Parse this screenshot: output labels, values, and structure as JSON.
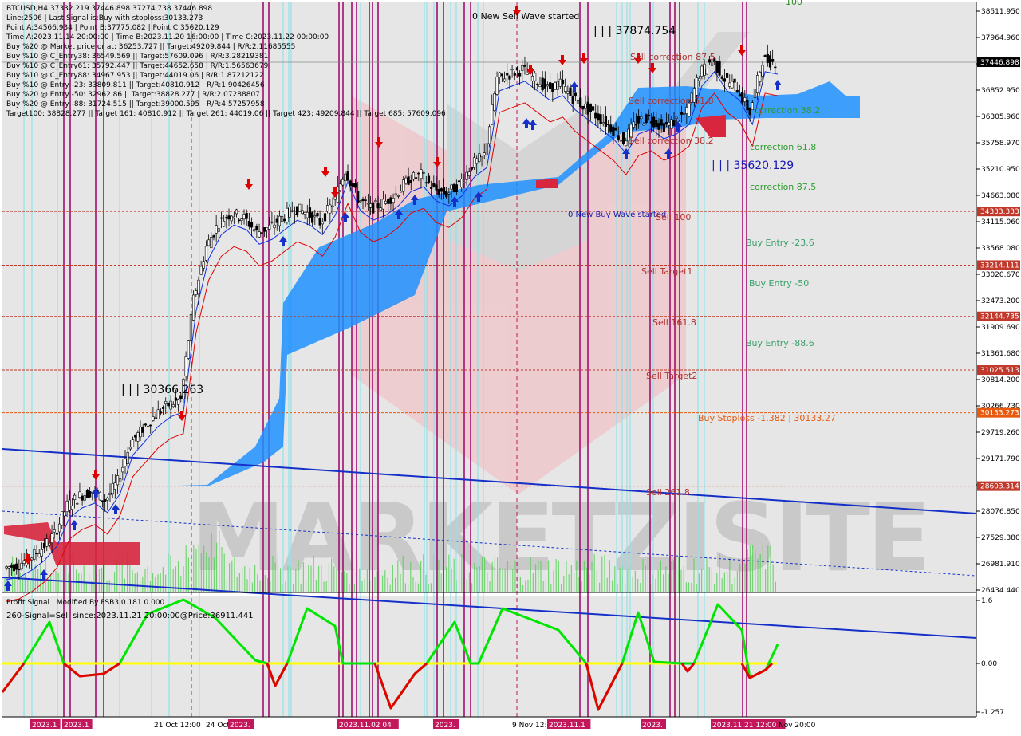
{
  "info_lines": [
    "BTCUSD,H4  37332.219 37446.898 37274.738 37446.898",
    "Line:2506 | Last Signal is:Buy with stoploss:30133.273",
    "Point A:34566.934 | Point B:37775.082 | Point C:35620.129",
    "Time A:2023.11.14 20:00:00 | Time B:2023.11.20 16:00:00 | Time C:2023.11.22 00:00:00",
    "Buy %20 @ Market price or at: 36253.727 || Target:49209.844 | R/R:2.11685555",
    "Buy %10 @ C_Entry38: 36549.569 || Target:57609.096 | R/R:3.28219381",
    "Buy %10 @ C_Entry61: 35792.447 || Target:44652.658 | R/R:1.56563679",
    "Buy %10 @ C_Entry88: 34967.953 || Target:44019.06 | R/R:1.87212122",
    "Buy %10 @ Entry -23: 33809.811 || Target:40810.912 | R/R:1.90426456",
    "Buy %20 @ Entry -50: 32962.86 || Target:38828.277 | R/R:2.07288807",
    "Buy %20 @ Entry -88: 31724.515 || Target:39000.595 | R/R:4.57257958",
    "Target100: 38828.277 || Target 161: 40810.912 || Target 261: 44019.06 || Target 423: 49209.844 || Target 685: 57609.096"
  ],
  "chart_labels": {
    "new_sell_wave": "0 New Sell Wave started",
    "new_buy_wave": "0 New Buy Wave started",
    "high_label": "| | | 37874.754",
    "low_label": "| | | 35620.129",
    "left_label": "| | | 30366.263",
    "top_right": "100",
    "sell_correction_875": "Sell correction 87.5",
    "sell_correction_618": "Sell correction 61.8",
    "sell_correction_382": "Sell correction 38.2",
    "correction_382": "correction 38.2",
    "correction_618": "correction 61.8",
    "correction_875": "correction 87.5",
    "sell_100": "Sell 100",
    "sell_target1": "Sell Target1",
    "sell_1618": "Sell 161.8",
    "sell_target2": "Sell Target2",
    "sell_2618": "Sell 261.8",
    "buy_entry_236": "Buy Entry -23.6",
    "buy_entry_50": "Buy Entry -50",
    "buy_entry_886": "Buy Entry -88.6",
    "buy_stoploss": "Buy Stoploss -1.382 | 30133.27"
  },
  "hlines": [
    {
      "price": 34333.333,
      "label": "34333.333",
      "color": "#c0392b"
    },
    {
      "price": 33214.111,
      "label": "33214.111",
      "color": "#c0392b"
    },
    {
      "price": 32144.735,
      "label": "32144.735",
      "color": "#c0392b"
    },
    {
      "price": 31025.513,
      "label": "31025.513",
      "color": "#c0392b"
    },
    {
      "price": 30133.273,
      "label": "30133.273",
      "color": "#e8590c"
    },
    {
      "price": 28603.314,
      "label": "28603.314",
      "color": "#c0392b"
    }
  ],
  "current_price": {
    "value": 37446.898,
    "label": "37446.898"
  },
  "price_ticks": [
    "38511.950",
    "37964.960",
    "37417.970",
    "36852.950",
    "36305.960",
    "35758.970",
    "35210.950",
    "34663.080",
    "34115.060",
    "33568.080",
    "33020.670",
    "32473.200",
    "31909.690",
    "31361.680",
    "30814.200",
    "30266.730",
    "29719.260",
    "29171.790",
    "28624.320",
    "28076.850",
    "27529.380",
    "26981.910",
    "26434.440"
  ],
  "price_range": [
    26434.44,
    38511.95
  ],
  "time_labels": [
    {
      "text": "2023.1",
      "bg": "#c2185b"
    },
    {
      "text": "2023.1",
      "bg": "#c2185b"
    },
    {
      "text": "21 Oct 12:00",
      "bg": ""
    },
    {
      "text": "24 Oct",
      "bg": ""
    },
    {
      "text": "2023.",
      "bg": "#c2185b"
    },
    {
      "text": "2023.11.02 04",
      "bg": "#c2185b"
    },
    {
      "text": "2023.",
      "bg": "#c2185b"
    },
    {
      "text": "9 Nov 12:0",
      "bg": ""
    },
    {
      "text": "2023.11.1",
      "bg": "#c2185b"
    },
    {
      "text": "2023.",
      "bg": "#c2185b"
    },
    {
      "text": "2023.11.21 12:00",
      "bg": "#c2185b"
    },
    {
      "text": "Nov 20:00",
      "bg": ""
    }
  ],
  "indicator": {
    "title": "Profit Signal | Modified By FSB3 0.181 0.000",
    "signal": "260-Signal=Sell since:2023.11.21 20:00:00@Price:36911.441",
    "ticks": [
      "1.6",
      "0.00",
      "-1.257"
    ]
  },
  "watermark": "MARKETZISITE",
  "colors": {
    "bull_candle": "#000000",
    "cloud_blue": "#1e90ff",
    "cloud_red": "#d7263d",
    "signal_green": "#00e600",
    "signal_red": "#e60000",
    "zero_line": "#ffff00",
    "vline_magenta": "#a0106e",
    "vline_cyan": "#8fe3ea",
    "trend_blue": "#1530c8"
  },
  "chart_data": {
    "type": "line",
    "title": "BTCUSD,H4",
    "ylim": [
      26434.44,
      38511.95
    ],
    "series": [
      {
        "name": "BTCUSD,H4",
        "values": [
          26900,
          26950,
          27100,
          27300,
          27600,
          28200,
          28400,
          28500,
          28300,
          28700,
          29500,
          29800,
          30100,
          30300,
          30400,
          32500,
          33600,
          34100,
          34300,
          34200,
          33900,
          34000,
          34200,
          34400,
          34300,
          34100,
          34500,
          35200,
          34600,
          34400,
          34500,
          34700,
          35000,
          35100,
          34800,
          34700,
          34900,
          35300,
          35500,
          37100,
          37200,
          37300,
          37100,
          36900,
          37000,
          36700,
          36500,
          36300,
          36100,
          35800,
          36200,
          36300,
          36100,
          36200,
          36400,
          37200,
          37500,
          37100,
          36900,
          36400,
          37500,
          37446.898
        ]
      }
    ]
  }
}
